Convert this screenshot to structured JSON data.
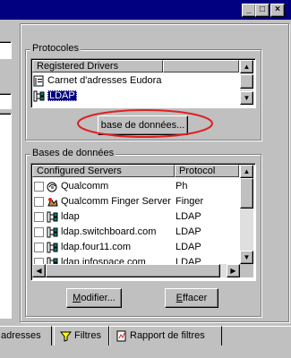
{
  "window": {
    "buttons": [
      {
        "name": "minimize-button",
        "glyph": "_"
      },
      {
        "name": "maximize-button",
        "glyph": "□"
      },
      {
        "name": "close-button",
        "glyph": "×"
      }
    ]
  },
  "protocols": {
    "group_label": "Protocoles",
    "column": "Registered Drivers",
    "items": [
      {
        "label": "Carnet d'adresses Eudora",
        "icon": "address-book-icon",
        "selected": false
      },
      {
        "label": "LDAP",
        "icon": "server-icon",
        "selected": true
      }
    ],
    "db_button": "base de données..."
  },
  "databases": {
    "group_label": "Bases de données",
    "columns": [
      "Configured Servers",
      "Protocol"
    ],
    "rows": [
      {
        "server": "Qualcomm",
        "protocol": "Ph",
        "icon": "ph-server-icon"
      },
      {
        "server": "Qualcomm Finger Server",
        "protocol": "Finger",
        "icon": "finger-server-icon"
      },
      {
        "server": "ldap",
        "protocol": "LDAP",
        "icon": "server-icon"
      },
      {
        "server": "ldap.switchboard.com",
        "protocol": "LDAP",
        "icon": "server-icon"
      },
      {
        "server": "ldap.four11.com",
        "protocol": "LDAP",
        "icon": "server-icon"
      },
      {
        "server": "ldap.infospace.com",
        "protocol": "LDAP",
        "icon": "server-icon"
      }
    ],
    "modify_first": "M",
    "modify_rest": "odifier...",
    "delete_first": "E",
    "delete_rest": "ffacer"
  },
  "tabs": [
    {
      "label": "adresses",
      "icon": ""
    },
    {
      "label": "Filtres",
      "icon": "filter-icon"
    },
    {
      "label": "Rapport de filtres",
      "icon": "report-icon"
    }
  ],
  "colors": {
    "titlebar": "#000080",
    "highlight": "#000080",
    "annotation": "#e02020"
  }
}
